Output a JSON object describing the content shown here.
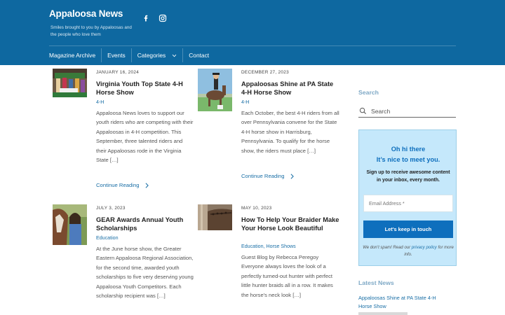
{
  "header": {
    "site_title": "Appaloosa News",
    "tagline": "Smiles brought to you by Appaloosas and the people who love them",
    "social": [
      "facebook-icon",
      "instagram-icon"
    ],
    "bg_color": "#0e68a0"
  },
  "nav": {
    "items": [
      {
        "label": "Magazine Archive"
      },
      {
        "label": "Events"
      },
      {
        "label": "Categories",
        "has_dropdown": true
      },
      {
        "label": "Contact"
      }
    ]
  },
  "posts": [
    {
      "date": "JANUARY 16, 2024",
      "title": "Virginia Youth Top State 4-H Horse Show",
      "categories": [
        "4-H"
      ],
      "excerpt": "Appaloosa News loves to support our youth riders who are competing with their Appaloosas in 4-H competition.  This September, three talented riders and their Appaloosas rode in the Virginia State […]",
      "more": "Continue Reading"
    },
    {
      "date": "DECEMBER 27, 2023",
      "title": "Appaloosas Shine at PA State 4-H Horse Show",
      "categories": [
        "4-H"
      ],
      "excerpt": "Each October, the best 4-H riders from all over Pennsylvania convene for the State 4-H horse show in Harrisburg, Pennsylvania.  To qualify for the horse show, the riders must place […]",
      "more": "Continue Reading"
    },
    {
      "date": "JULY 3, 2023",
      "title": "GEAR Awards Annual Youth Scholarships",
      "categories": [
        "Education"
      ],
      "excerpt": "At the June horse show, the Greater Eastern Appaloosa Regional Association, for the second time, awarded youth scholarships to five very deserving young Appaloosa Youth Competitors.  Each scholarship recipient was […]"
    },
    {
      "date": "MAY 10, 2023",
      "title": "How To Help Your Braider Make Your Horse Look Beautiful",
      "categories": [
        "Education",
        "Horse Shows"
      ],
      "excerpt": "Guest Blog by Rebecca Peregoy Everyone always loves the look of a perfectly turned-out hunter with perfect little hunter braids all in a row. It makes the horse's neck look […]"
    }
  ],
  "sidebar": {
    "search_title": "Search",
    "search_placeholder": "Search",
    "optin": {
      "heading1": "Oh hi there",
      "heading2": "It’s nice to meet you.",
      "subtext": "Sign up to receive awesome content in your inbox, every month.",
      "email_placeholder": "Email Address *",
      "button": "Let's keep in touch",
      "note_before": "We don’t spam! Read our ",
      "note_link": "privacy policy",
      "note_after": " for more info.",
      "bg_color": "#c5e8fb",
      "accent_color": "#0e6fbd"
    },
    "latest_title": "Latest News",
    "latest": [
      {
        "title": "Appaloosas Shine at PA State 4-H Horse Show"
      }
    ]
  }
}
